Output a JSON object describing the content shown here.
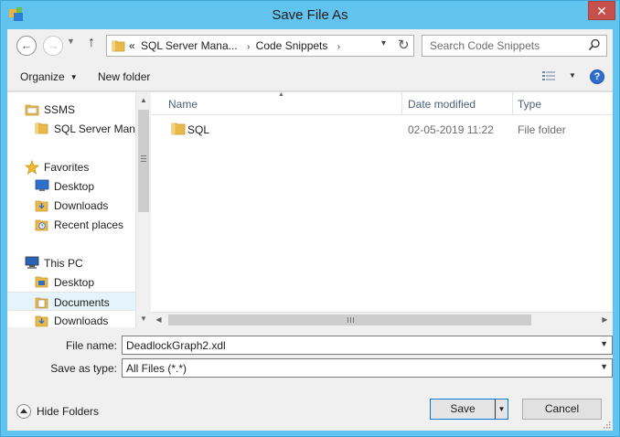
{
  "window": {
    "title": "Save File As",
    "close_glyph": "✕"
  },
  "nav": {
    "back_glyph": "←",
    "forward_glyph": "→",
    "up_glyph": "↑",
    "refresh_glyph": "↻",
    "address": {
      "overflow": "«",
      "segments": [
        "SQL Server Mana...",
        "Code Snippets"
      ],
      "separator": "›"
    },
    "search_placeholder": "Search Code Snippets"
  },
  "commandbar": {
    "organize": "Organize",
    "new_folder": "New folder",
    "help_glyph": "?"
  },
  "navpane": {
    "items": [
      {
        "label": "SSMS",
        "icon": "ssms-icon"
      },
      {
        "label": "SQL Server Mana",
        "icon": "folder-icon"
      },
      {
        "label": "Favorites",
        "icon": "star-icon"
      },
      {
        "label": "Desktop",
        "icon": "desktop-icon"
      },
      {
        "label": "Downloads",
        "icon": "downloads-icon"
      },
      {
        "label": "Recent places",
        "icon": "recent-places-icon"
      },
      {
        "label": "This PC",
        "icon": "computer-icon"
      },
      {
        "label": "Desktop",
        "icon": "folder-icon"
      },
      {
        "label": "Documents",
        "icon": "documents-icon"
      },
      {
        "label": "Downloads",
        "icon": "downloads-icon"
      }
    ]
  },
  "filelist": {
    "columns": {
      "name": "Name",
      "date": "Date modified",
      "type": "Type"
    },
    "rows": [
      {
        "name": "SQL",
        "date": "02-05-2019 11:22",
        "type": "File folder"
      }
    ]
  },
  "form": {
    "filename_label": "File name:",
    "filename_value": "DeadlockGraph2.xdl",
    "type_label": "Save as type:",
    "type_value": "All Files (*.*)"
  },
  "footer": {
    "hide_folders": "Hide Folders",
    "save": "Save",
    "cancel": "Cancel"
  },
  "colors": {
    "titlebar": "#63c3ef",
    "close": "#c7504b",
    "folder": "#e8b94a",
    "accent": "#0078d7"
  }
}
